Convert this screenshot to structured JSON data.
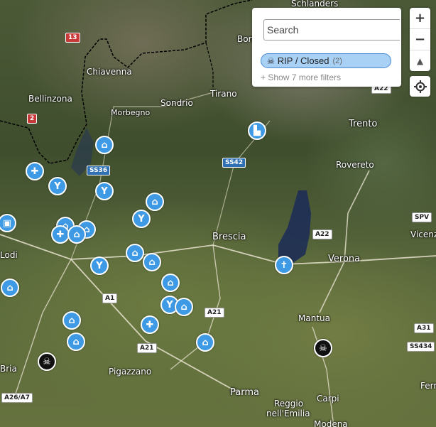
{
  "search": {
    "placeholder": "Search"
  },
  "filter": {
    "chip_label": "RIP / Closed",
    "chip_count": "(2)",
    "more_filters": "+ Show 7 more filters"
  },
  "controls": {
    "zoom_in": "+",
    "zoom_out": "−",
    "compass": "▲"
  },
  "places": [
    {
      "name": "Schlanders"
    },
    {
      "name": "Bormio"
    },
    {
      "name": "Chiavenna"
    },
    {
      "name": "Bellinzona"
    },
    {
      "name": "Sondrio"
    },
    {
      "name": "Tirano"
    },
    {
      "name": "Morbegno"
    },
    {
      "name": "Trento"
    },
    {
      "name": "Rovereto"
    },
    {
      "name": "Brescia"
    },
    {
      "name": "Verona"
    },
    {
      "name": "Vicenza"
    },
    {
      "name": "Mantua"
    },
    {
      "name": "Parma"
    },
    {
      "name": "Reggio"
    },
    {
      "name": "nell'Emilia"
    },
    {
      "name": "Carpi"
    },
    {
      "name": "Pigazzano"
    },
    {
      "name": "Modena"
    },
    {
      "name": "Ferrara"
    },
    {
      "name": "Lodi"
    },
    {
      "name": "Bria"
    }
  ],
  "roads": [
    {
      "label": "13"
    },
    {
      "label": "2"
    },
    {
      "label": "SS36"
    },
    {
      "label": "SS42"
    },
    {
      "label": "A22"
    },
    {
      "label": "A22"
    },
    {
      "label": "SPV"
    },
    {
      "label": "A1"
    },
    {
      "label": "A21"
    },
    {
      "label": "A21"
    },
    {
      "label": "A31"
    },
    {
      "label": "SS434"
    },
    {
      "label": "A26/A7"
    }
  ],
  "markers": [
    {
      "type": "house"
    },
    {
      "type": "factory"
    },
    {
      "type": "cross"
    },
    {
      "type": "cocktail"
    },
    {
      "type": "cocktail"
    },
    {
      "type": "house"
    },
    {
      "type": "cocktail"
    },
    {
      "type": "house"
    },
    {
      "type": "house"
    },
    {
      "type": "cross"
    },
    {
      "type": "house"
    },
    {
      "type": "tram"
    },
    {
      "type": "house"
    },
    {
      "type": "cocktail"
    },
    {
      "type": "house"
    },
    {
      "type": "house"
    },
    {
      "type": "cocktail"
    },
    {
      "type": "house"
    },
    {
      "type": "house"
    },
    {
      "type": "cross"
    },
    {
      "type": "house"
    },
    {
      "type": "house"
    },
    {
      "type": "cross"
    },
    {
      "type": "skull"
    },
    {
      "type": "skull"
    }
  ],
  "colors": {
    "marker_blue": "#3f9ae6",
    "chip_bg": "#a9d0f5",
    "closed_marker": "#111111"
  }
}
